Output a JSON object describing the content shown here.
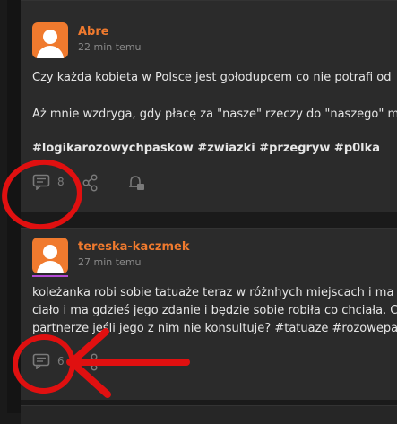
{
  "posts": [
    {
      "username": "Abre",
      "time": "22 min temu",
      "lines": [
        "Czy każda kobieta w Polsce jest gołodupcem co nie potrafi od",
        "Aż mnie wzdryga, gdy płacę za \"nasze\" rzeczy do \"naszego\" m",
        "#logikarozowychpaskow #zwiazki #przegryw #p0lka"
      ],
      "comments_count": "8"
    },
    {
      "username": "tereska-kaczmek",
      "time": "27 min temu",
      "lines": [
        "koleżanka robi sobie tatuaże teraz w różnhych miejscach i ma",
        "ciało i ma gdzieś jego zdanie i będzie sobie robiła co chciała. C",
        "partnerze jeśli jego z nim nie konsultuje? #tatuaze #rozowepa"
      ],
      "comments_count": "6"
    }
  ],
  "colors": {
    "accent": "#f07a2e",
    "annotation": "#e01010",
    "card": "#2b2b2b",
    "background": "#1a1a1a"
  },
  "icons": [
    "user-avatar-icon",
    "comment-icon",
    "share-icon",
    "bell-icon"
  ]
}
